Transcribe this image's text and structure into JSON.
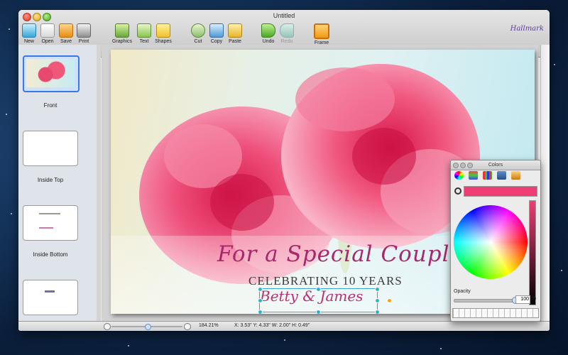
{
  "window": {
    "title": "Untitled",
    "brand": "Hallmark"
  },
  "toolbar": {
    "new": "New",
    "open": "Open",
    "save": "Save",
    "print": "Print",
    "graphics": "Graphics",
    "text": "Text",
    "shapes": "Shapes",
    "cut": "Cut",
    "copy": "Copy",
    "paste": "Paste",
    "undo": "Undo",
    "redo": "Redo",
    "frame": "Frame"
  },
  "sidebar": {
    "items": [
      {
        "label": "Front"
      },
      {
        "label": "Inside Top"
      },
      {
        "label": "Inside Bottom"
      },
      {
        "label": ""
      }
    ]
  },
  "card": {
    "headline": "For a Special Couple",
    "subline": "CELEBRATING 10 YEARS",
    "names": "Betty & James"
  },
  "status": {
    "zoom": "184.21%",
    "geometry": "X: 3.53\" Y: 4.33\" W: 2.00\" H: 0.49\""
  },
  "colors_panel": {
    "title": "Colors",
    "opacity_label": "Opacity",
    "opacity_value": "100",
    "opacity_unit": "%",
    "selected_color": "#ee3e73"
  }
}
